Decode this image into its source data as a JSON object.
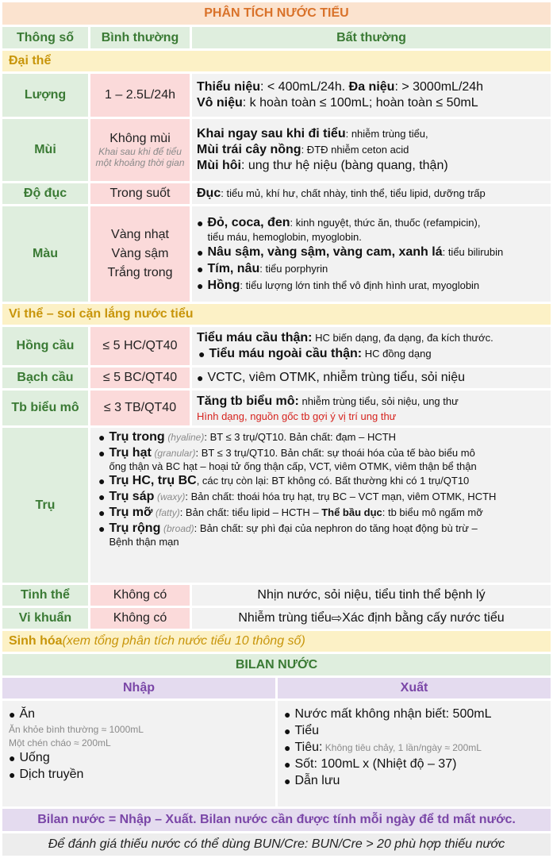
{
  "title": "PHÂN TÍCH NƯỚC TIỂU",
  "headers": [
    "Thông số",
    "Bình thường",
    "Bất thường"
  ],
  "section_macro": "Đại thể",
  "luong": {
    "name": "Lượng",
    "normal": "1 – 2.5L/24h",
    "l1_b1": "Thiểu niệu",
    "l1_t1": ": < 400mL/24h. ",
    "l1_b2": "Đa niệu",
    "l1_t2": ": > 3000mL/24h",
    "l2_b1": "Vô niệu",
    "l2_t1": ": k hoàn toàn ≤ 100mL; hoàn toàn ≤ 50mL"
  },
  "mui": {
    "name": "Mùi",
    "normal": "Không mùi",
    "normal_note": "Khai sau khi để tiểu một khoảng thời gian",
    "l1_b": "Khai ngay sau khi đi tiểu",
    "l1_t": ": nhiễm trùng tiểu,",
    "l2_b": "Mùi trái cây nồng",
    "l2_t": ": ĐTĐ nhiễm ceton acid",
    "l3_b": "Mùi hôi",
    "l3_t": ": ung thư hệ niệu (bàng quang, thận)"
  },
  "doduc": {
    "name": "Độ đục",
    "normal": "Trong suốt",
    "b": "Đục",
    "t": ": tiểu mủ, khí hư, chất nhày, tinh thể, tiểu lipid, dưỡng trấp"
  },
  "mau": {
    "name": "Màu",
    "normal": [
      "Vàng nhạt",
      "Vàng sậm",
      "Trắng trong"
    ],
    "i1_b": "Đỏ, coca, đen",
    "i1_t": ": kinh nguyệt, thức ăn, thuốc (refampicin),",
    "i1_t2": "tiểu máu, hemoglobin, myoglobin.",
    "i2_b": "Nâu sậm, vàng sậm, vàng cam, xanh lá",
    "i2_t": ": tiểu bilirubin",
    "i3_b": "Tím, nâu",
    "i3_t": ": tiểu porphyrin",
    "i4_b": "Hồng",
    "i4_t": ": tiểu lượng lớn tinh thể vô định hình urat, myoglobin"
  },
  "section_micro": "Vi thể – soi cặn lắng nước tiểu",
  "hongcau": {
    "name": "Hồng cầu",
    "normal": "≤ 5 HC/QT40",
    "l1_b": "Tiểu máu cầu thận:",
    "l1_t": " HC biến dạng, đa dạng, đa kích thước.",
    "l2_b": "Tiểu máu ngoài cầu thận:",
    "l2_t": " HC đồng dạng"
  },
  "bachcau": {
    "name": "Bạch cầu",
    "normal": "≤ 5 BC/QT40",
    "t": "VCTC, viêm OTMK, nhiễm trùng tiểu, sỏi niệu"
  },
  "tbbieumo": {
    "name": "Tb biểu mô",
    "normal": "≤ 3 TB/QT40",
    "b": "Tăng tb biểu mô:",
    "t": " nhiễm trùng tiểu, sỏi niệu, ung thư",
    "red": "Hình dạng, nguồn gốc tb gợi ý vị trí ung thư"
  },
  "tru": {
    "name": "Trụ",
    "items": [
      {
        "b": "Trụ trong",
        "g": "(hyaline)",
        "t": ": BT ≤ 3 trụ/QT10. Bản chất: đạm – HCTH",
        "t2": "",
        "b2": "",
        "t3": ""
      },
      {
        "b": "Trụ hạt",
        "g": "(granular)",
        "t": ": BT ≤ 3 trụ/QT10. Bản chất: sự thoái hóa của tế bào biểu mô",
        "t2": "ống thận và BC hạt – hoại tử ống thận cấp, VCT, viêm OTMK, viêm thận bể thận",
        "b2": "",
        "t3": ""
      },
      {
        "b": "Trụ HC, trụ BC",
        "g": "",
        "t": ", các trụ còn lại: BT không có. Bất thường khi có 1 trụ/QT10",
        "t2": "",
        "b2": "",
        "t3": ""
      },
      {
        "b": "Trụ sáp",
        "g": "(waxy)",
        "t": ": Bản chất: thoái hóa trụ hạt, trụ BC – VCT mạn, viêm OTMK, HCTH",
        "t2": "",
        "b2": "",
        "t3": ""
      },
      {
        "b": "Trụ mỡ",
        "g": "(fatty)",
        "t": ": Bản chất: tiểu lipid – HCTH – ",
        "t2": "",
        "b2": "Thể bầu dục",
        "t3": ": tb biểu mô ngấm mỡ"
      },
      {
        "b": "Trụ rộng",
        "g": "(broad)",
        "t": ": Bản chất: sự phì đại của nephron do tăng hoạt động bù trừ –",
        "t2": "Bệnh thận mạn",
        "b2": "",
        "t3": ""
      }
    ]
  },
  "tinhthe": {
    "name": "Tinh thể",
    "normal": "Không có",
    "t": "Nhịn nước, sỏi niệu, tiểu tinh thể bệnh lý"
  },
  "vikhuan": {
    "name": "Vi khuẩn",
    "normal": "Không có",
    "t1": "Nhiễm trùng tiểu ",
    "arrow": "⇨",
    "t2": " Xác định bằng cấy nước tiểu"
  },
  "sinhhoa": {
    "b": "Sinh hóa",
    "i": " (xem tổng phân tích nước tiểu 10 thông số)"
  },
  "bilan": {
    "title": "BILAN NƯỚC",
    "nhap_h": "Nhập",
    "xuat_h": "Xuất",
    "nhap": {
      "an": "Ăn",
      "an_n1": "Ăn khỏe bình thường ≈ 1000mL",
      "an_n2": "Một chén cháo ≈ 200mL",
      "uong": "Uống",
      "dich": "Dịch truyền"
    },
    "xuat": {
      "x1": "Nước mất không nhận biết: 500mL",
      "x2": "Tiểu",
      "x3": "Tiêu:",
      "x3_n": " Không tiêu chảy, 1 lần/ngày ≈ 200mL",
      "x4": "Sốt: 100mL x (Nhiệt độ – 37)",
      "x5": "Dẫn lưu"
    },
    "footer1": "Bilan nước = Nhập – Xuất. Bilan nước cần được tính mỗi ngày để td mất nước.",
    "footer2": "Để đánh giá thiếu nước có thể dùng BUN/Cre: BUN/Cre > 20 phù hợp thiếu nước"
  },
  "colors": {
    "green": "#3a7a34",
    "orange": "#d9722a",
    "gold": "#c8950a",
    "purple": "#7a46a7",
    "red": "#d6231e"
  }
}
